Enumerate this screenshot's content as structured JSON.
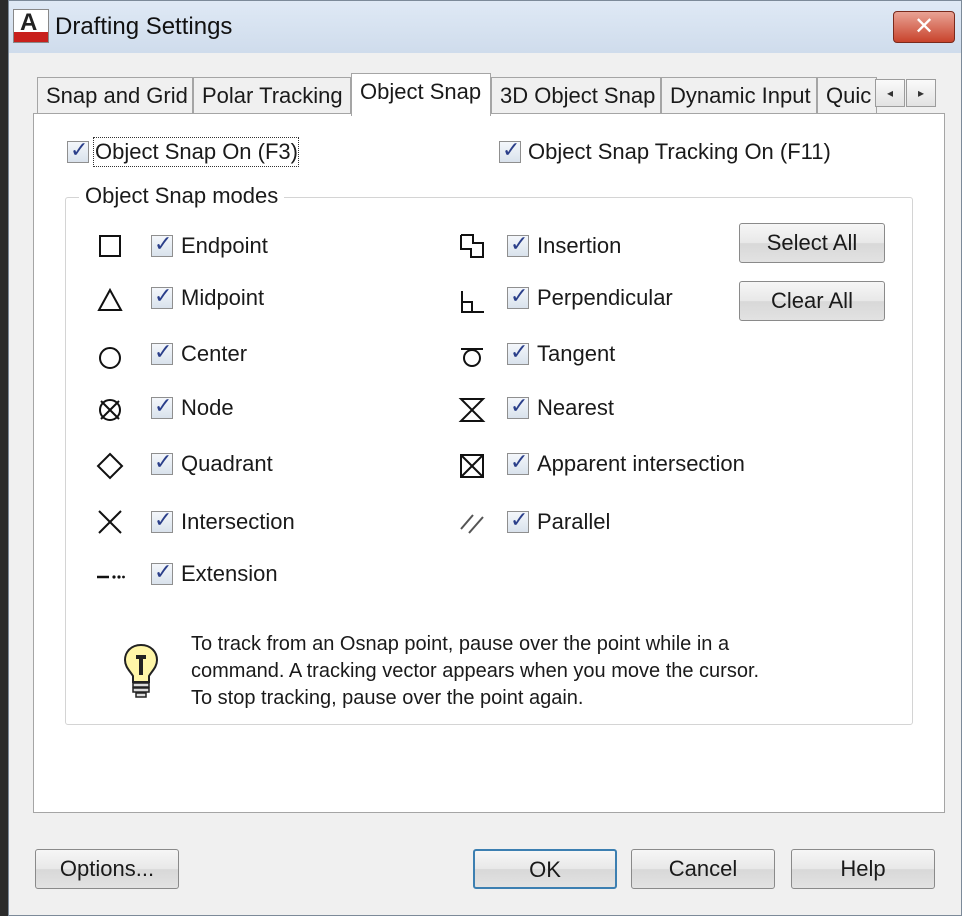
{
  "window": {
    "title": "Drafting Settings",
    "close_glyph": "✕",
    "app_icon_letter": "A"
  },
  "tabs": [
    {
      "label": "Snap and Grid",
      "active": false
    },
    {
      "label": "Polar Tracking",
      "active": false
    },
    {
      "label": "Object Snap",
      "active": true
    },
    {
      "label": "3D Object Snap",
      "active": false
    },
    {
      "label": "Dynamic Input",
      "active": false
    },
    {
      "label": "Quic",
      "active": false
    }
  ],
  "tab_scroll": {
    "left": "◂",
    "right": "▸"
  },
  "top_options": {
    "object_snap_on": {
      "label": "Object Snap On (F3)",
      "checked": true
    },
    "object_snap_tracking_on": {
      "label": "Object Snap Tracking On (F11)",
      "checked": true
    }
  },
  "modes_group": {
    "title": "Object Snap modes",
    "left_column": [
      {
        "label": "Endpoint",
        "marker": "square-marker-icon",
        "checked": true
      },
      {
        "label": "Midpoint",
        "marker": "triangle-marker-icon",
        "checked": true
      },
      {
        "label": "Center",
        "marker": "circle-marker-icon",
        "checked": true
      },
      {
        "label": "Node",
        "marker": "node-marker-icon",
        "checked": true
      },
      {
        "label": "Quadrant",
        "marker": "diamond-marker-icon",
        "checked": true
      },
      {
        "label": "Intersection",
        "marker": "x-marker-icon",
        "checked": true
      },
      {
        "label": "Extension",
        "marker": "extension-marker-icon",
        "checked": true
      }
    ],
    "right_column": [
      {
        "label": "Insertion",
        "marker": "insertion-marker-icon",
        "checked": true
      },
      {
        "label": "Perpendicular",
        "marker": "perpendicular-marker-icon",
        "checked": true
      },
      {
        "label": "Tangent",
        "marker": "tangent-marker-icon",
        "checked": true
      },
      {
        "label": "Nearest",
        "marker": "nearest-marker-icon",
        "checked": true
      },
      {
        "label": "Apparent intersection",
        "marker": "apparent-intersection-marker-icon",
        "checked": true
      },
      {
        "label": "Parallel",
        "marker": "parallel-marker-icon",
        "checked": true
      }
    ],
    "select_all_label": "Select All",
    "clear_all_label": "Clear All"
  },
  "tip": {
    "icon": "lightbulb-icon",
    "line1": "To track from an Osnap point, pause over the point while in a",
    "line2": "command.  A tracking vector appears when you move the cursor.",
    "line3": "To stop tracking, pause over the point again."
  },
  "footer": {
    "options_label": "Options...",
    "ok_label": "OK",
    "cancel_label": "Cancel",
    "help_label": "Help"
  },
  "colors": {
    "accent_border": "#3c7fb1",
    "check_tick": "#2b3f8a",
    "close_red": "#c8432c"
  }
}
